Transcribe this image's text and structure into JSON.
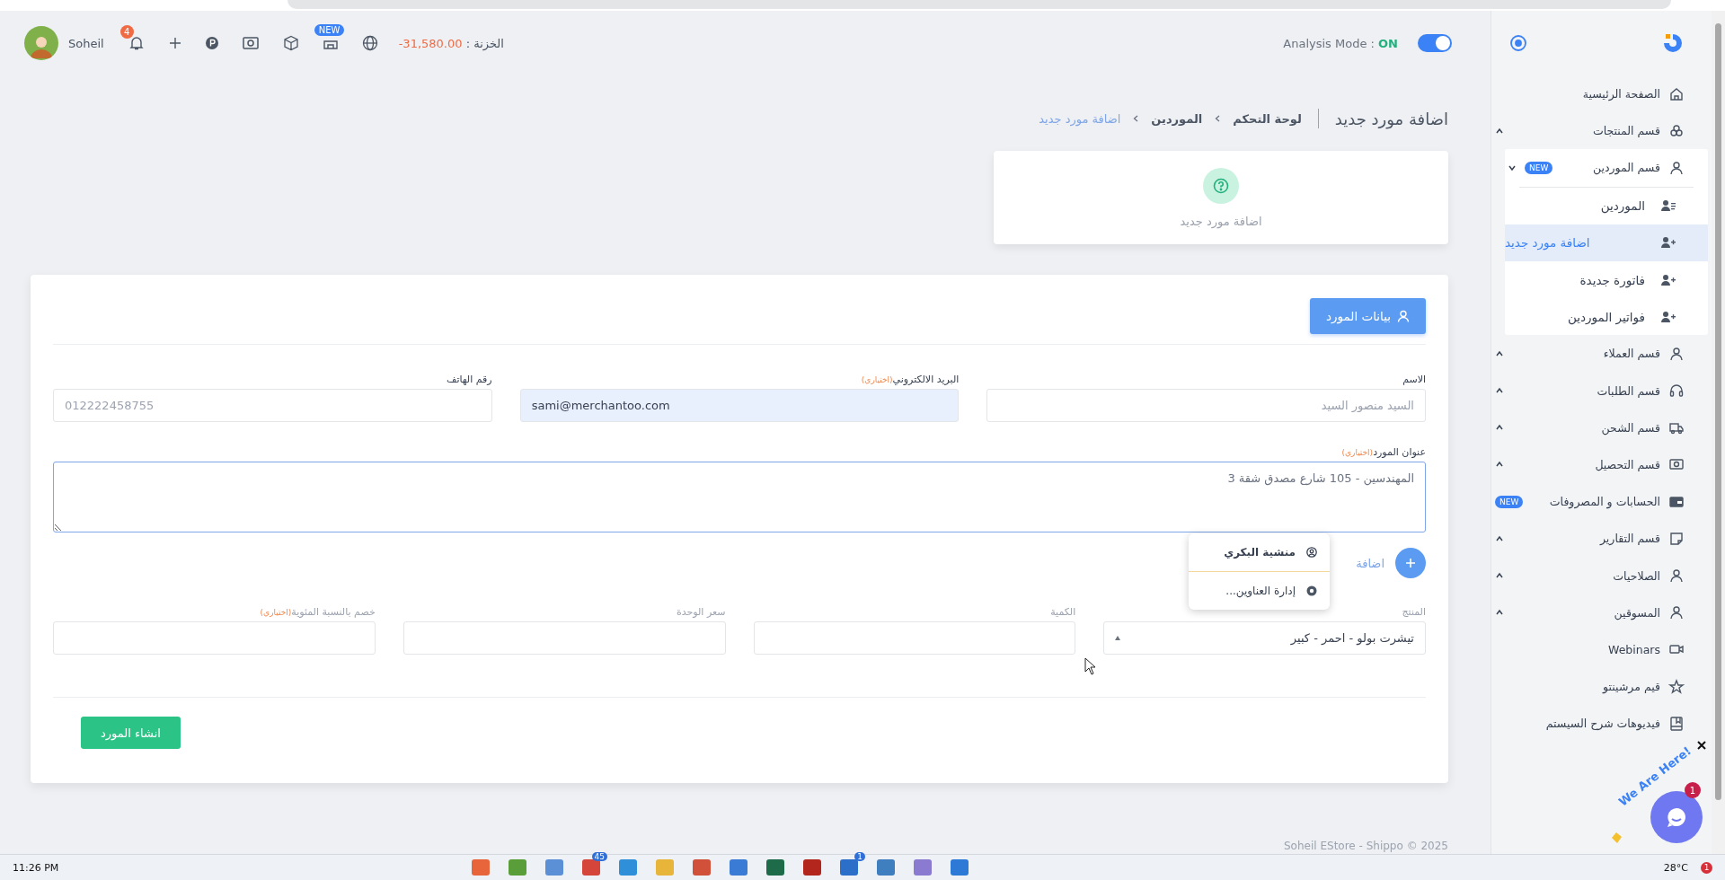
{
  "topbar": {
    "user_name": "Soheil",
    "notification_count": "4",
    "new_badge": "NEW",
    "treasury_label": "الخزنة :",
    "treasury_value": "-31,580.00",
    "analysis_mode_label": "Analysis Mode :",
    "analysis_mode_value": "ON",
    "analysis_mode_on": true
  },
  "sidebar": {
    "items": [
      {
        "label": "الصفحة الرئيسية"
      },
      {
        "label": "قسم المنتجات",
        "expanded": false
      },
      {
        "label": "قسم الموردين",
        "expanded": true,
        "badge": "NEW",
        "children": [
          {
            "label": "الموردين",
            "selected": false
          },
          {
            "label": "اضافة مورد جديد",
            "selected": true
          },
          {
            "label": "فاتورة جديدة",
            "selected": false
          },
          {
            "label": "فواتير الموردين",
            "selected": false
          }
        ]
      },
      {
        "label": "قسم العملاء",
        "expanded": false
      },
      {
        "label": "قسم الطلبات",
        "expanded": false
      },
      {
        "label": "قسم الشحن",
        "expanded": false
      },
      {
        "label": "قسم التحصيل",
        "expanded": false
      },
      {
        "label": "الحسابات و المصروفات",
        "badge": "NEW"
      },
      {
        "label": "قسم التقارير",
        "expanded": false
      },
      {
        "label": "الصلاحيات",
        "expanded": false
      },
      {
        "label": "المسوقين",
        "expanded": false
      },
      {
        "label": "Webinars"
      },
      {
        "label": "قيم مرشينتو"
      },
      {
        "label": "فيديوهات شرح السيستم"
      }
    ]
  },
  "page_title": "اضافة مورد جديد",
  "breadcrumb": [
    {
      "label": "لوحة التحكم",
      "current": false
    },
    {
      "label": "الموردين",
      "current": false
    },
    {
      "label": "اضافة مورد جديد",
      "current": true
    }
  ],
  "summary_card": {
    "label": "اضافة مورد جديد"
  },
  "form": {
    "section_button": "بيانات المورد",
    "fields": [
      {
        "label": "الاسم",
        "placeholder": "السيد منصور السيد",
        "autofilled": false
      },
      {
        "label": "البريد الالكتروني",
        "optional_note": "(اختياري)",
        "value": "sami@merchantoo.com",
        "autofilled": true
      },
      {
        "label": "رقم الهاتف",
        "placeholder": "012222458755",
        "autofilled": false
      }
    ],
    "address": {
      "label": "عنوان المورد",
      "optional_note": "(اختياري)",
      "placeholder": "المهندسين - 105 شارع مصدق شقة 3"
    },
    "add_address_link": "اضافة",
    "autofill_menu": [
      {
        "label": "منشية البكري",
        "emphasized": true
      },
      {
        "label": "إدارة العناوين...",
        "emphasized": false
      }
    ],
    "product_row": [
      {
        "kind": "select",
        "label": "المنتج",
        "value": "تيشرت بولو - احمر - كبير"
      },
      {
        "kind": "input",
        "label": "الكمية"
      },
      {
        "kind": "input",
        "label": "سعر الوحدة"
      },
      {
        "kind": "input",
        "label": "خصم بالنسبة المئوية",
        "optional_note": "(اختياري)"
      }
    ],
    "submit_button": "انشاء المورد"
  },
  "footer": "Soheil EStore - Shippo © 2025",
  "chat_widget": {
    "tagline": "We Are Here!",
    "unread_count": "1"
  },
  "taskbar": {
    "time": "11:26 PM",
    "temperature": "28°C",
    "notification_count": "1",
    "apps": [
      {
        "color": "#2d7ad6"
      },
      {
        "color": "#8a7bd0"
      },
      {
        "color": "#3f7fc0"
      },
      {
        "color": "#2c6fc9",
        "badge": "1"
      },
      {
        "color": "#b3261e"
      },
      {
        "color": "#1e6b4a"
      },
      {
        "color": "#3a7bd5"
      },
      {
        "color": "#d0503a"
      },
      {
        "color": "#e7b53a"
      },
      {
        "color": "#2f8fd8"
      },
      {
        "color": "#d6453a",
        "badge": "45"
      },
      {
        "color": "#5b8fd6"
      },
      {
        "color": "#5a9e3a"
      },
      {
        "color": "#e8643a"
      }
    ]
  }
}
